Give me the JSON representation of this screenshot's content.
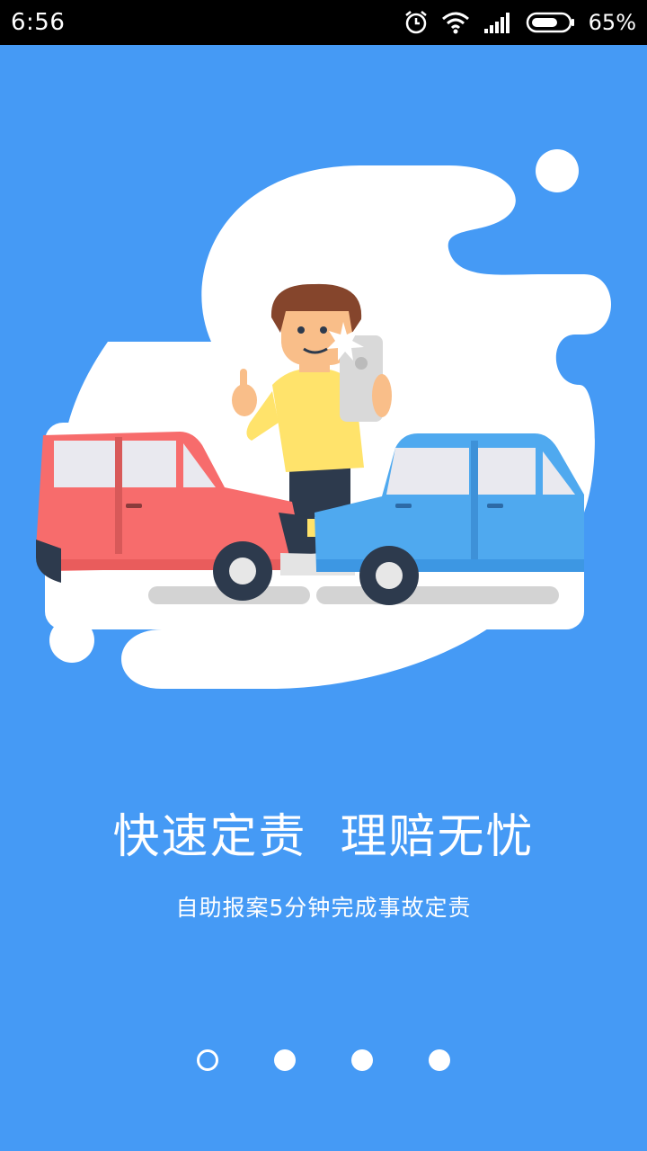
{
  "status_bar": {
    "time": "6:56",
    "battery_percent": "65%",
    "icons": [
      "alarm-icon",
      "wifi-icon",
      "signal-icon",
      "battery-icon"
    ]
  },
  "onboarding": {
    "headline": "快速定责  理赔无忧",
    "subline": "自助报案5分钟完成事故定责",
    "page_indicator": {
      "total": 4,
      "active_index": 0
    }
  },
  "colors": {
    "background": "#459af5",
    "red_car": "#f76c6c",
    "blue_car": "#4fa9ef",
    "shirt": "#ffe36b"
  }
}
